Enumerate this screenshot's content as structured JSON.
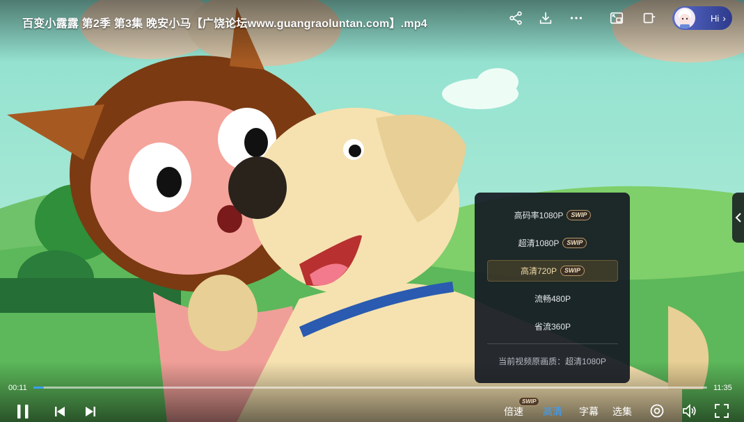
{
  "header": {
    "title": "百变小露露 第2季 第3集 晚安小马【广饶论坛www.guangraoluntan.com】.mp4",
    "icons": [
      "share-icon",
      "download-icon",
      "more-icon",
      "picture-in-picture-icon",
      "window-icon"
    ],
    "hi_label": "Hi",
    "hi_chevron": "›"
  },
  "quality_menu": {
    "items": [
      {
        "label": "高码率1080P",
        "badge": "SWIP",
        "selected": false
      },
      {
        "label": "超清1080P",
        "badge": "SWIP",
        "selected": false
      },
      {
        "label": "高清720P",
        "badge": "SWIP",
        "selected": true
      },
      {
        "label": "流畅480P",
        "badge": "",
        "selected": false
      },
      {
        "label": "省流360P",
        "badge": "",
        "selected": false
      }
    ],
    "current_source": "当前视频原画质：超清1080P"
  },
  "player": {
    "current_time": "00:11",
    "total_time": "11:35",
    "progress": 0.016,
    "speed_label": "倍速",
    "speed_badge": "SWIP",
    "quality_label": "高清",
    "subtitle_label": "字幕",
    "episodes_label": "选集"
  },
  "colors": {
    "accent": "#3aa0ff",
    "menu_bg": "#161b24",
    "selected_border": "#6a5a3a"
  }
}
